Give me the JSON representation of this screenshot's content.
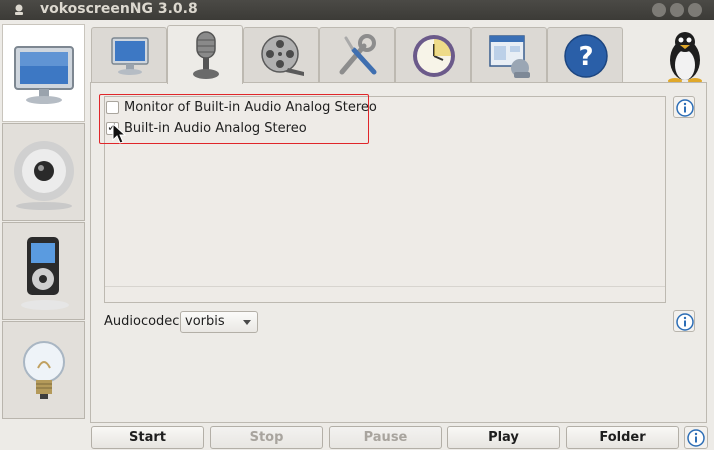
{
  "window": {
    "title": "vokoscreenNG 3.0.8"
  },
  "sidebar": {
    "items": [
      {
        "name": "screencast",
        "icon": "monitor-icon",
        "active": true
      },
      {
        "name": "camera",
        "icon": "webcam-icon",
        "active": false
      },
      {
        "name": "player",
        "icon": "media-player-icon",
        "active": false
      },
      {
        "name": "log",
        "icon": "lightbulb-icon",
        "active": false
      }
    ]
  },
  "tabs": [
    {
      "name": "screen",
      "icon": "monitor-icon",
      "active": false
    },
    {
      "name": "audio",
      "icon": "microphone-icon",
      "active": true
    },
    {
      "name": "video",
      "icon": "film-reel-icon",
      "active": false
    },
    {
      "name": "misc",
      "icon": "tools-icon",
      "active": false
    },
    {
      "name": "timer",
      "icon": "clock-icon",
      "active": false
    },
    {
      "name": "system",
      "icon": "window-icon",
      "active": false
    },
    {
      "name": "about",
      "icon": "help-icon",
      "active": false
    }
  ],
  "audio": {
    "devices": [
      {
        "label": "Monitor of Built-in Audio Analog Stereo",
        "checked": false
      },
      {
        "label": "Built-in Audio Analog Stereo",
        "checked": true
      }
    ],
    "codec_label": "Audiocodec",
    "codec_value": "vorbis"
  },
  "buttons": {
    "start": "Start",
    "stop": "Stop",
    "pause": "Pause",
    "play": "Play",
    "folder": "Folder"
  },
  "colors": {
    "highlight": "#e0262a",
    "info": "#2c6db5",
    "titlebar": "#3c3b37"
  }
}
